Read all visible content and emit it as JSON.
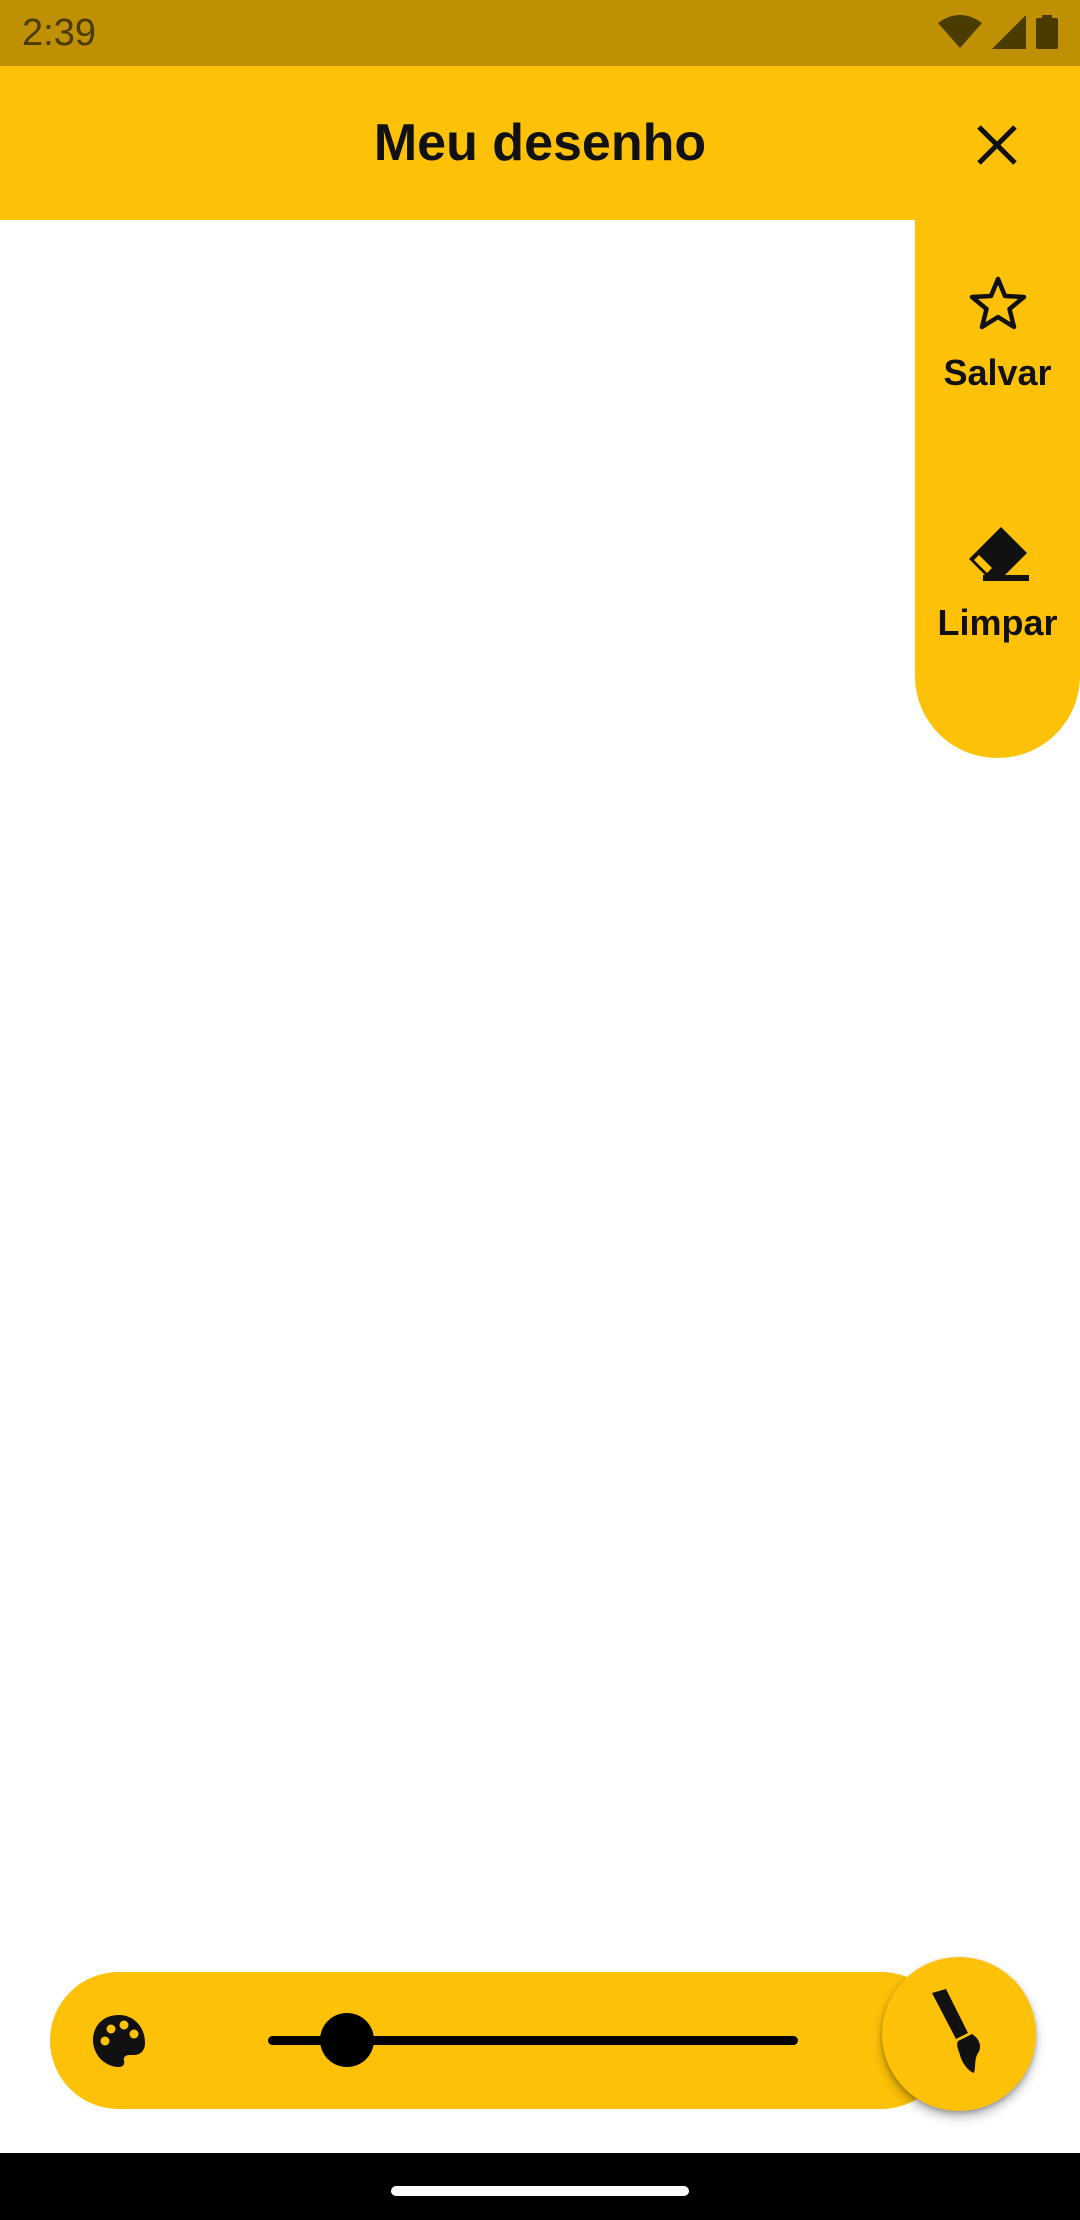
{
  "status_bar": {
    "time": "2:39",
    "icons": [
      "wifi-icon",
      "signal-icon",
      "battery-icon"
    ]
  },
  "app_bar": {
    "title": "Meu desenho",
    "close_icon": "close-icon"
  },
  "side_menu": {
    "items": [
      {
        "label": "Salvar",
        "icon": "star-outline-icon"
      },
      {
        "label": "Limpar",
        "icon": "eraser-icon"
      }
    ]
  },
  "bottom_toolbar": {
    "palette_icon": "palette-icon",
    "brush_size_fraction": 0.11
  },
  "fab": {
    "icon": "brush-icon"
  },
  "colors": {
    "accent": "#FDC107",
    "status_bar": "#BF9004",
    "canvas": "#FFFFFF",
    "nav_bar": "#000000"
  }
}
